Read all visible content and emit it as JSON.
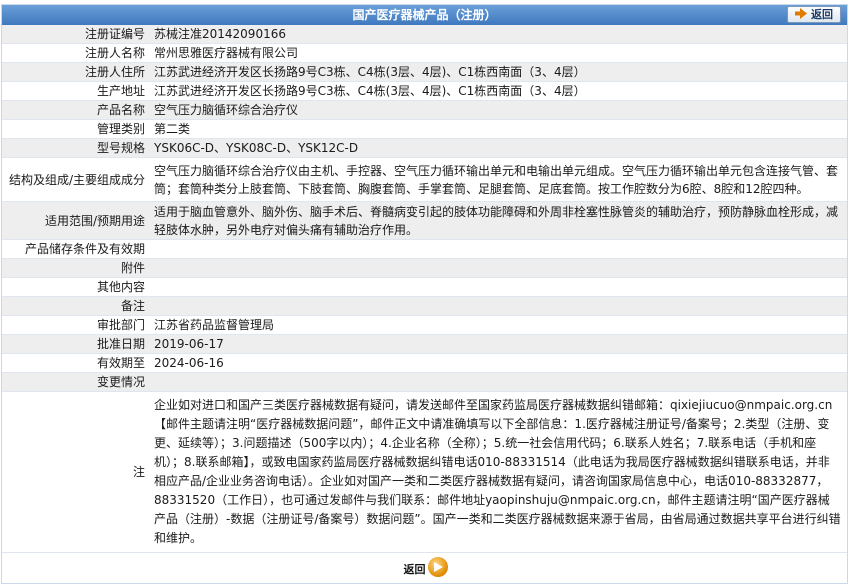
{
  "header": {
    "title": "国产医疗器械产品（注册）",
    "back_label": "返回"
  },
  "rows": [
    {
      "label": "注册证编号",
      "value": "苏械注准20142090166"
    },
    {
      "label": "注册人名称",
      "value": "常州思雅医疗器械有限公司"
    },
    {
      "label": "注册人住所",
      "value": "江苏武进经济开发区长扬路9号C3栋、C4栋(3层、4层)、C1栋西南面（3、4层）"
    },
    {
      "label": "生产地址",
      "value": "江苏武进经济开发区长扬路9号C3栋、C4栋(3层、4层)、C1栋西南面（3、4层）"
    },
    {
      "label": "产品名称",
      "value": "空气压力脑循环综合治疗仪"
    },
    {
      "label": "管理类别",
      "value": "第二类"
    },
    {
      "label": "型号规格",
      "value": "YSK06C-D、YSK08C-D、YSK12C-D"
    },
    {
      "label": "结构及组成/主要组成成分",
      "value": "空气压力脑循环综合治疗仪由主机、手控器、空气压力循环输出单元和电输出单元组成。空气压力循环输出单元包含连接气管、套筒；套筒种类分上肢套筒、下肢套筒、胸腹套筒、手掌套筒、足腿套筒、足底套筒。按工作腔数分为6腔、8腔和12腔四种。"
    },
    {
      "label": "适用范围/预期用途",
      "value": "适用于脑血管意外、脑外伤、脑手术后、脊髓病变引起的肢体功能障碍和外周非栓塞性脉管炎的辅助治疗，预防静脉血栓形成，减轻肢体水肿，另外电疗对偏头痛有辅助治疗作用。"
    },
    {
      "label": "产品储存条件及有效期",
      "value": ""
    },
    {
      "label": "附件",
      "value": ""
    },
    {
      "label": "其他内容",
      "value": ""
    },
    {
      "label": "备注",
      "value": ""
    },
    {
      "label": "审批部门",
      "value": "江苏省药品监督管理局"
    },
    {
      "label": "批准日期",
      "value": "2019-06-17"
    },
    {
      "label": "有效期至",
      "value": "2024-06-16"
    },
    {
      "label": "变更情况",
      "value": ""
    }
  ],
  "note": {
    "label": "注",
    "text": "企业如对进口和国产三类医疗器械数据有疑问，请发送邮件至国家药监局医疗器械数据纠错邮箱：qixiejiucuo@nmpaic.org.cn【邮件主题请注明“医疗器械数据问题”，邮件正文中请准确填写以下全部信息：1.医疗器械注册证号/备案号；2.类型（注册、变更、延续等）；3.问题描述（500字以内）；4.企业名称（全称）；5.统一社会信用代码；6.联系人姓名；7.联系电话（手机和座机）；8.联系邮箱】，或致电国家药监局医疗器械数据纠错电话010-88331514（此电话为我局医疗器械数据纠错联系电话，并非相应产品/企业业务咨询电话）。企业如对国产一类和二类医疗器械数据有疑问，请咨询国家局信息中心，电话010-88332877，88331520（工作日），也可通过发邮件与我们联系：邮件地址yaopinshuju@nmpaic.org.cn，邮件主题请注明“国产医疗器械产品（注册）-数据（注册证号/备案号）数据问题”。国产一类和二类医疗器械数据来源于省局，由省局通过数据共享平台进行纠错和维护。"
  },
  "footer": {
    "back_label": "返回"
  }
}
